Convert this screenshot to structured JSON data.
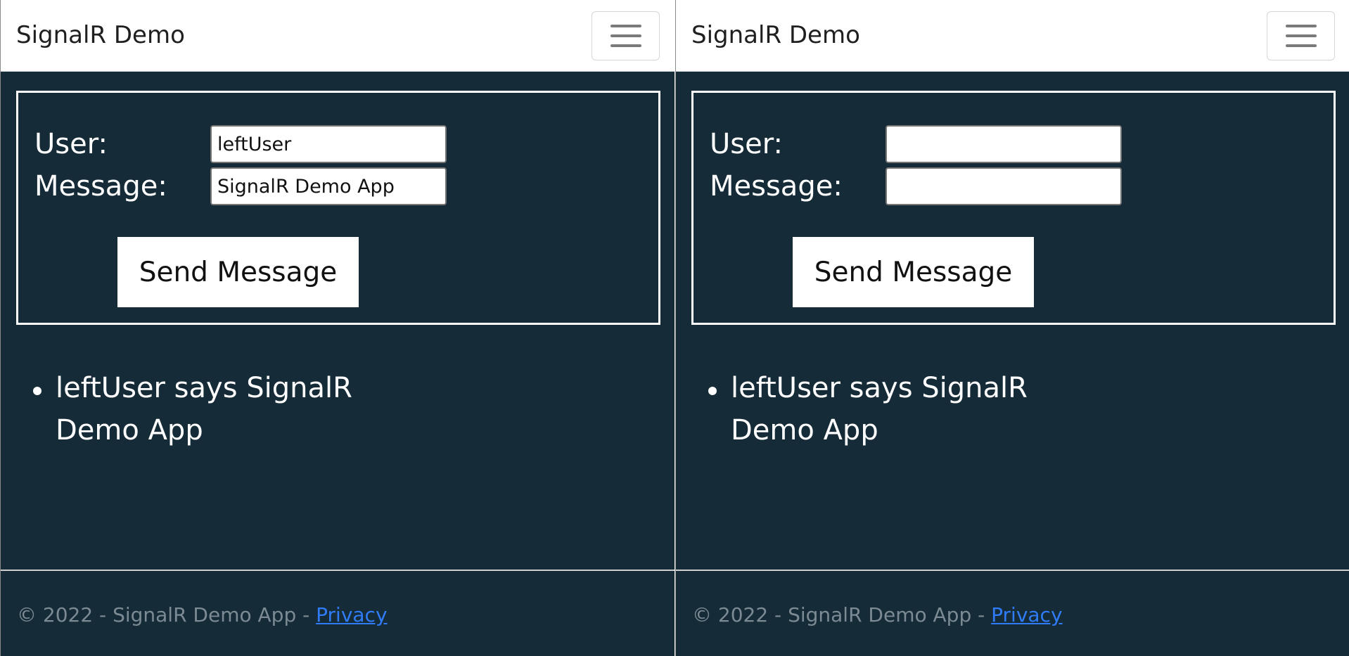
{
  "panes": [
    {
      "brand": "SignalR Demo",
      "form": {
        "user_label": "User:",
        "message_label": "Message:",
        "user_value": "leftUser",
        "message_value": "SignalR Demo App",
        "send_label": "Send Message"
      },
      "messages": [
        "leftUser says SignalR Demo App"
      ],
      "footer": {
        "text": "© 2022 - SignalR Demo App - ",
        "privacy_link": "Privacy"
      }
    },
    {
      "brand": "SignalR Demo",
      "form": {
        "user_label": "User:",
        "message_label": "Message:",
        "user_value": "",
        "message_value": "",
        "send_label": "Send Message"
      },
      "messages": [
        "leftUser says SignalR Demo App"
      ],
      "footer": {
        "text": "© 2022 - SignalR Demo App - ",
        "privacy_link": "Privacy"
      }
    }
  ],
  "icons": {
    "menu": "hamburger-menu-icon",
    "bullet": "bullet-icon"
  },
  "colors": {
    "background": "#152b38",
    "navbar": "#ffffff",
    "link": "#2f7cf6",
    "footer_text": "#7c8a93"
  }
}
